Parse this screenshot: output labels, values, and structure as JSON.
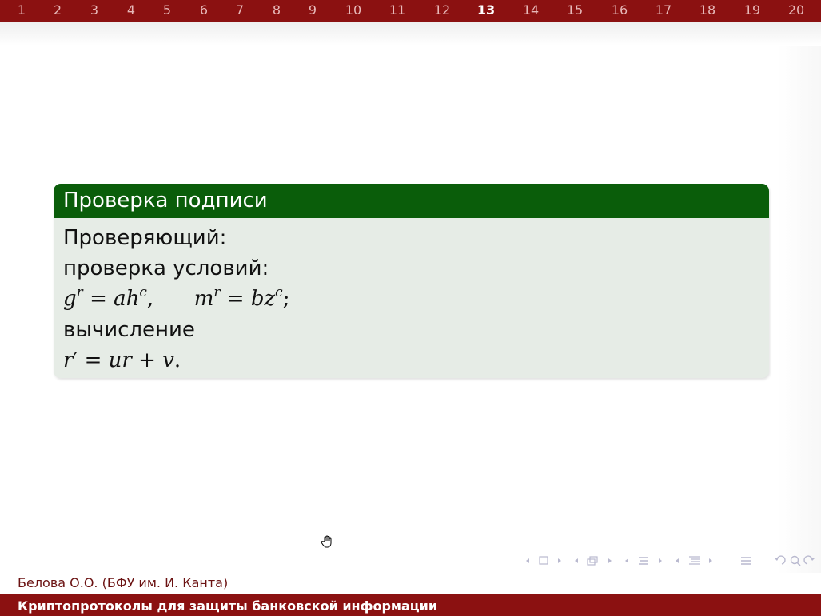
{
  "slide_numbers": [
    "1",
    "2",
    "3",
    "4",
    "5",
    "6",
    "7",
    "8",
    "9",
    "10",
    "11",
    "12",
    "13",
    "14",
    "15",
    "16",
    "17",
    "18",
    "19",
    "20"
  ],
  "current_slide": "13",
  "block": {
    "title": "Проверка подписи",
    "line1": "Проверяющий:",
    "line2": "проверка условий:",
    "eq1": {
      "g": "g",
      "r1": "r",
      "eq": "=",
      "ah": "ah",
      "c1": "c",
      "comma": ",",
      "m": "m",
      "r2": "r",
      "bz": "bz",
      "c2": "c",
      "semi": ";"
    },
    "line4": "вычисление",
    "eq2": {
      "r": "r",
      "prime": "′",
      "eq": "=",
      "ur": "ur",
      "plus": "+",
      "v": "v",
      "dot": "."
    }
  },
  "footer": {
    "author": "Белова О.О. (БФУ им. И. Канта)",
    "title": "Криптопротоколы для защиты банковской информации"
  },
  "icons": [
    "hand-cursor-icon",
    "frame-nav-icon",
    "subsection-nav-icon",
    "section-nav-icon",
    "document-nav-icon",
    "undo-icon",
    "search-icon",
    "redo-icon"
  ],
  "colors": {
    "header_bar": "#8b1111",
    "block_title": "#0a5d0a",
    "block_body": "#e6ece6",
    "nav": "#b9b9cf"
  }
}
